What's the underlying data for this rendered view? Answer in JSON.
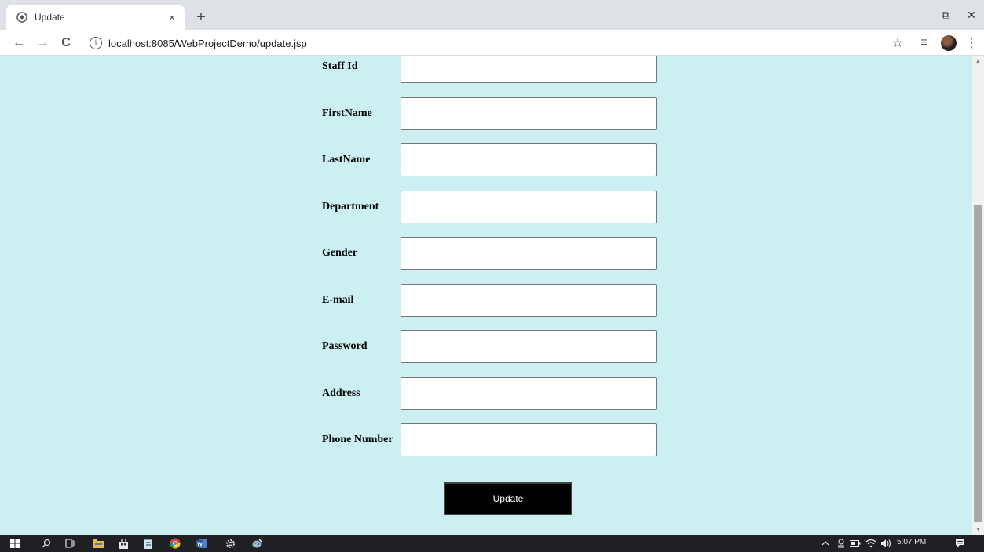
{
  "browser": {
    "tab_title": "Update",
    "tab_close": "×",
    "new_tab": "+",
    "url": "localhost:8085/WebProjectDemo/update.jsp",
    "info_glyph": "i",
    "window_controls": {
      "minimize": "–",
      "restore": "⧉",
      "close": "✕"
    },
    "nav": {
      "back": "←",
      "forward": "→",
      "reload": "C"
    },
    "toolbar_icons": {
      "bookmark": "☆",
      "reading_list": "≡",
      "menu": "⋮"
    }
  },
  "form": {
    "fields": [
      {
        "label": "Staff Id",
        "value": ""
      },
      {
        "label": "FirstName",
        "value": ""
      },
      {
        "label": "LastName",
        "value": ""
      },
      {
        "label": "Department",
        "value": ""
      },
      {
        "label": "Gender",
        "value": ""
      },
      {
        "label": "E-mail",
        "value": ""
      },
      {
        "label": "Password",
        "value": ""
      },
      {
        "label": "Address",
        "value": ""
      },
      {
        "label": "Phone Number",
        "value": ""
      }
    ],
    "submit_label": "Update"
  },
  "taskbar": {
    "clock": "5:07 PM",
    "icons": [
      "windows-start-icon",
      "search-icon",
      "task-view-icon",
      "file-explorer-icon",
      "store-icon",
      "notepad-icon",
      "chrome-icon",
      "word-icon",
      "settings-icon",
      "paint-icon"
    ],
    "tray_icons": [
      "chevron-up-icon",
      "meet-icon",
      "battery-icon",
      "wifi-icon",
      "volume-icon",
      "notification-icon"
    ]
  },
  "colors": {
    "page_background": "#ccf0f2",
    "button_background": "#000000",
    "button_text": "#ffffff"
  }
}
